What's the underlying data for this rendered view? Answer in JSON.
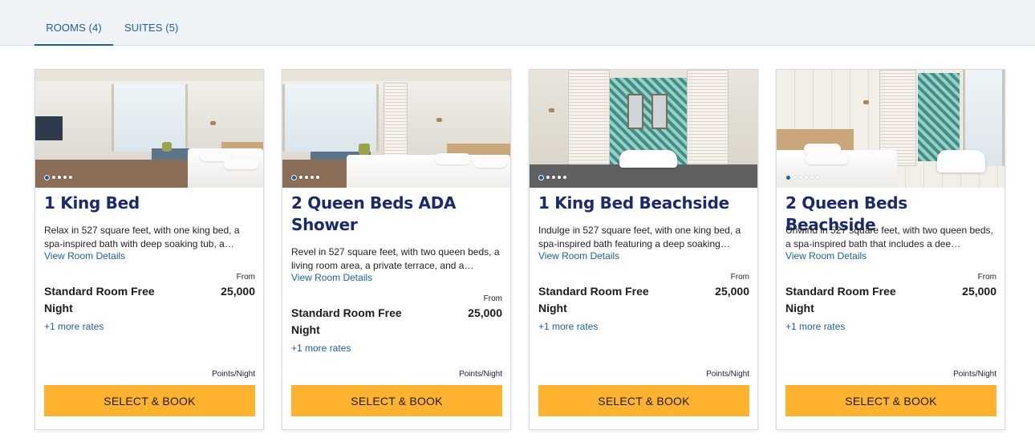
{
  "tabs": [
    {
      "label": "ROOMS (4)",
      "active": true
    },
    {
      "label": "SUITES (5)",
      "active": false
    }
  ],
  "colors": {
    "accent": "#1d5f9c",
    "button": "#ffb230",
    "title": "#1b2a6b"
  },
  "cards": [
    {
      "title": "1 King Bed",
      "description": "Relax in 527 square feet, with one king bed, a spa-inspired bath with deep soaking tub, a…",
      "details_link": "View Room Details",
      "from_label": "From",
      "rate_name": "Standard Room Free Night",
      "rate_value": "25,000",
      "more_rates": "+1 more rates",
      "unit": "Points/Night",
      "button": "SELECT & BOOK",
      "photo_icon": "bedroom-photo"
    },
    {
      "title": "2 Queen Beds ADA Shower",
      "description": "Revel in 527 square feet, with two queen beds, a living room area, a private terrace, and a…",
      "details_link": "View Room Details",
      "from_label": "From",
      "rate_name": "Standard Room Free Night",
      "rate_value": "25,000",
      "more_rates": "+1 more rates",
      "unit": "Points/Night",
      "button": "SELECT & BOOK",
      "photo_icon": "bedroom-photo"
    },
    {
      "title": "1 King Bed Beachside",
      "description": "Indulge in 527 square feet, with one king bed, a spa-inspired bath featuring a deep soaking…",
      "details_link": "View Room Details",
      "from_label": "From",
      "rate_name": "Standard Room Free Night",
      "rate_value": "25,000",
      "more_rates": "+1 more rates",
      "unit": "Points/Night",
      "button": "SELECT & BOOK",
      "photo_icon": "bathroom-photo"
    },
    {
      "title": "2 Queen Beds Beachside",
      "description": "Unwind in 527 square feet, with two queen beds, a spa-inspired bath that includes a dee…",
      "details_link": "View Room Details",
      "from_label": "From",
      "rate_name": "Standard Room Free Night",
      "rate_value": "25,000",
      "more_rates": "+1 more rates",
      "unit": "Points/Night",
      "button": "SELECT & BOOK",
      "photo_icon": "bedroom-bath-photo"
    }
  ]
}
